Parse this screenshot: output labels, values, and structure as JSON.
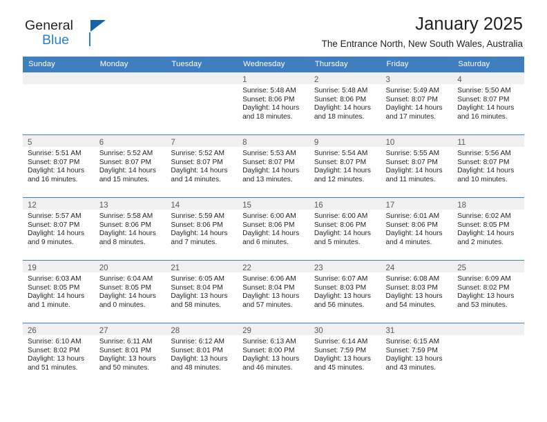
{
  "brand": {
    "name_dark": "General",
    "name_blue": "Blue",
    "accent_color": "#2981c9",
    "triangle_color": "#1463a8"
  },
  "header": {
    "title": "January 2025",
    "subtitle": "The Entrance North, New South Wales, Australia"
  },
  "calendar": {
    "header_bg": "#3f7fbf",
    "daynum_bg": "#f0f0f0",
    "weekday_headers": [
      "Sunday",
      "Monday",
      "Tuesday",
      "Wednesday",
      "Thursday",
      "Friday",
      "Saturday"
    ],
    "weeks": [
      [
        {
          "empty": true
        },
        {
          "empty": true
        },
        {
          "empty": true
        },
        {
          "day": "1",
          "sunrise": "Sunrise: 5:48 AM",
          "sunset": "Sunset: 8:06 PM",
          "daylight": "Daylight: 14 hours and 18 minutes."
        },
        {
          "day": "2",
          "sunrise": "Sunrise: 5:48 AM",
          "sunset": "Sunset: 8:06 PM",
          "daylight": "Daylight: 14 hours and 18 minutes."
        },
        {
          "day": "3",
          "sunrise": "Sunrise: 5:49 AM",
          "sunset": "Sunset: 8:07 PM",
          "daylight": "Daylight: 14 hours and 17 minutes."
        },
        {
          "day": "4",
          "sunrise": "Sunrise: 5:50 AM",
          "sunset": "Sunset: 8:07 PM",
          "daylight": "Daylight: 14 hours and 16 minutes."
        }
      ],
      [
        {
          "day": "5",
          "sunrise": "Sunrise: 5:51 AM",
          "sunset": "Sunset: 8:07 PM",
          "daylight": "Daylight: 14 hours and 16 minutes."
        },
        {
          "day": "6",
          "sunrise": "Sunrise: 5:52 AM",
          "sunset": "Sunset: 8:07 PM",
          "daylight": "Daylight: 14 hours and 15 minutes."
        },
        {
          "day": "7",
          "sunrise": "Sunrise: 5:52 AM",
          "sunset": "Sunset: 8:07 PM",
          "daylight": "Daylight: 14 hours and 14 minutes."
        },
        {
          "day": "8",
          "sunrise": "Sunrise: 5:53 AM",
          "sunset": "Sunset: 8:07 PM",
          "daylight": "Daylight: 14 hours and 13 minutes."
        },
        {
          "day": "9",
          "sunrise": "Sunrise: 5:54 AM",
          "sunset": "Sunset: 8:07 PM",
          "daylight": "Daylight: 14 hours and 12 minutes."
        },
        {
          "day": "10",
          "sunrise": "Sunrise: 5:55 AM",
          "sunset": "Sunset: 8:07 PM",
          "daylight": "Daylight: 14 hours and 11 minutes."
        },
        {
          "day": "11",
          "sunrise": "Sunrise: 5:56 AM",
          "sunset": "Sunset: 8:07 PM",
          "daylight": "Daylight: 14 hours and 10 minutes."
        }
      ],
      [
        {
          "day": "12",
          "sunrise": "Sunrise: 5:57 AM",
          "sunset": "Sunset: 8:07 PM",
          "daylight": "Daylight: 14 hours and 9 minutes."
        },
        {
          "day": "13",
          "sunrise": "Sunrise: 5:58 AM",
          "sunset": "Sunset: 8:06 PM",
          "daylight": "Daylight: 14 hours and 8 minutes."
        },
        {
          "day": "14",
          "sunrise": "Sunrise: 5:59 AM",
          "sunset": "Sunset: 8:06 PM",
          "daylight": "Daylight: 14 hours and 7 minutes."
        },
        {
          "day": "15",
          "sunrise": "Sunrise: 6:00 AM",
          "sunset": "Sunset: 8:06 PM",
          "daylight": "Daylight: 14 hours and 6 minutes."
        },
        {
          "day": "16",
          "sunrise": "Sunrise: 6:00 AM",
          "sunset": "Sunset: 8:06 PM",
          "daylight": "Daylight: 14 hours and 5 minutes."
        },
        {
          "day": "17",
          "sunrise": "Sunrise: 6:01 AM",
          "sunset": "Sunset: 8:06 PM",
          "daylight": "Daylight: 14 hours and 4 minutes."
        },
        {
          "day": "18",
          "sunrise": "Sunrise: 6:02 AM",
          "sunset": "Sunset: 8:05 PM",
          "daylight": "Daylight: 14 hours and 2 minutes."
        }
      ],
      [
        {
          "day": "19",
          "sunrise": "Sunrise: 6:03 AM",
          "sunset": "Sunset: 8:05 PM",
          "daylight": "Daylight: 14 hours and 1 minute."
        },
        {
          "day": "20",
          "sunrise": "Sunrise: 6:04 AM",
          "sunset": "Sunset: 8:05 PM",
          "daylight": "Daylight: 14 hours and 0 minutes."
        },
        {
          "day": "21",
          "sunrise": "Sunrise: 6:05 AM",
          "sunset": "Sunset: 8:04 PM",
          "daylight": "Daylight: 13 hours and 58 minutes."
        },
        {
          "day": "22",
          "sunrise": "Sunrise: 6:06 AM",
          "sunset": "Sunset: 8:04 PM",
          "daylight": "Daylight: 13 hours and 57 minutes."
        },
        {
          "day": "23",
          "sunrise": "Sunrise: 6:07 AM",
          "sunset": "Sunset: 8:03 PM",
          "daylight": "Daylight: 13 hours and 56 minutes."
        },
        {
          "day": "24",
          "sunrise": "Sunrise: 6:08 AM",
          "sunset": "Sunset: 8:03 PM",
          "daylight": "Daylight: 13 hours and 54 minutes."
        },
        {
          "day": "25",
          "sunrise": "Sunrise: 6:09 AM",
          "sunset": "Sunset: 8:02 PM",
          "daylight": "Daylight: 13 hours and 53 minutes."
        }
      ],
      [
        {
          "day": "26",
          "sunrise": "Sunrise: 6:10 AM",
          "sunset": "Sunset: 8:02 PM",
          "daylight": "Daylight: 13 hours and 51 minutes."
        },
        {
          "day": "27",
          "sunrise": "Sunrise: 6:11 AM",
          "sunset": "Sunset: 8:01 PM",
          "daylight": "Daylight: 13 hours and 50 minutes."
        },
        {
          "day": "28",
          "sunrise": "Sunrise: 6:12 AM",
          "sunset": "Sunset: 8:01 PM",
          "daylight": "Daylight: 13 hours and 48 minutes."
        },
        {
          "day": "29",
          "sunrise": "Sunrise: 6:13 AM",
          "sunset": "Sunset: 8:00 PM",
          "daylight": "Daylight: 13 hours and 46 minutes."
        },
        {
          "day": "30",
          "sunrise": "Sunrise: 6:14 AM",
          "sunset": "Sunset: 7:59 PM",
          "daylight": "Daylight: 13 hours and 45 minutes."
        },
        {
          "day": "31",
          "sunrise": "Sunrise: 6:15 AM",
          "sunset": "Sunset: 7:59 PM",
          "daylight": "Daylight: 13 hours and 43 minutes."
        },
        {
          "empty": true
        }
      ]
    ]
  }
}
